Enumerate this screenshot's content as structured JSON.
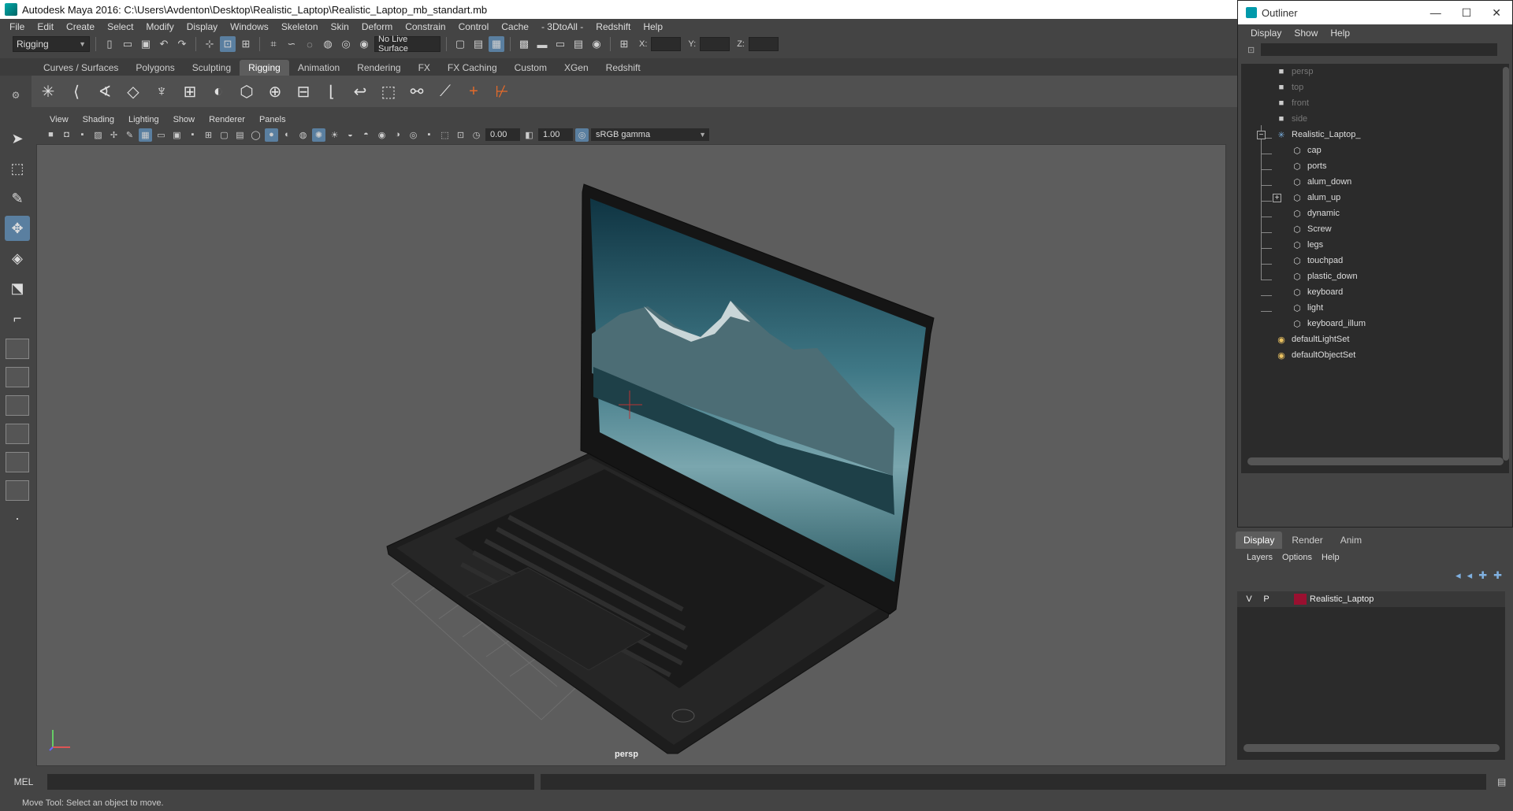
{
  "window": {
    "title": "Autodesk Maya 2016: C:\\Users\\Avdenton\\Desktop\\Realistic_Laptop\\Realistic_Laptop_mb_standart.mb"
  },
  "menubar": [
    "File",
    "Edit",
    "Create",
    "Select",
    "Modify",
    "Display",
    "Windows",
    "Skeleton",
    "Skin",
    "Deform",
    "Constrain",
    "Control",
    "Cache",
    "- 3DtoAll -",
    "Redshift",
    "Help"
  ],
  "statusline": {
    "menuset": "Rigging",
    "live_surface": "No Live Surface",
    "coord_x_label": "X:",
    "coord_y_label": "Y:",
    "coord_z_label": "Z:"
  },
  "shelf": {
    "tabs": [
      "Curves / Surfaces",
      "Polygons",
      "Sculpting",
      "Rigging",
      "Animation",
      "Rendering",
      "FX",
      "FX Caching",
      "Custom",
      "XGen",
      "Redshift"
    ],
    "active_tab": "Rigging"
  },
  "viewport": {
    "menu": [
      "View",
      "Shading",
      "Lighting",
      "Show",
      "Renderer",
      "Panels"
    ],
    "exposure": "0.00",
    "gamma": "1.00",
    "color_space": "sRGB gamma",
    "camera": "persp"
  },
  "commandline": {
    "mel_label": "MEL"
  },
  "helpline": {
    "text": "Move Tool: Select an object to move."
  },
  "outliner": {
    "title": "Outliner",
    "menu": [
      "Display",
      "Show",
      "Help"
    ],
    "cameras": [
      "persp",
      "top",
      "front",
      "side"
    ],
    "root": "Realistic_Laptop_",
    "children": [
      "cap",
      "ports",
      "alum_down",
      "alum_up",
      "dynamic",
      "Screw",
      "legs",
      "touchpad",
      "plastic_down",
      "keyboard",
      "light",
      "keyboard_illum"
    ],
    "sets": [
      "defaultLightSet",
      "defaultObjectSet"
    ]
  },
  "layers": {
    "tabs": [
      "Display",
      "Render",
      "Anim"
    ],
    "active_tab": "Display",
    "menu": [
      "Layers",
      "Options",
      "Help"
    ],
    "rows": [
      {
        "v": "V",
        "p": "P",
        "name": "Realistic_Laptop",
        "color": "#9a1030"
      }
    ]
  }
}
